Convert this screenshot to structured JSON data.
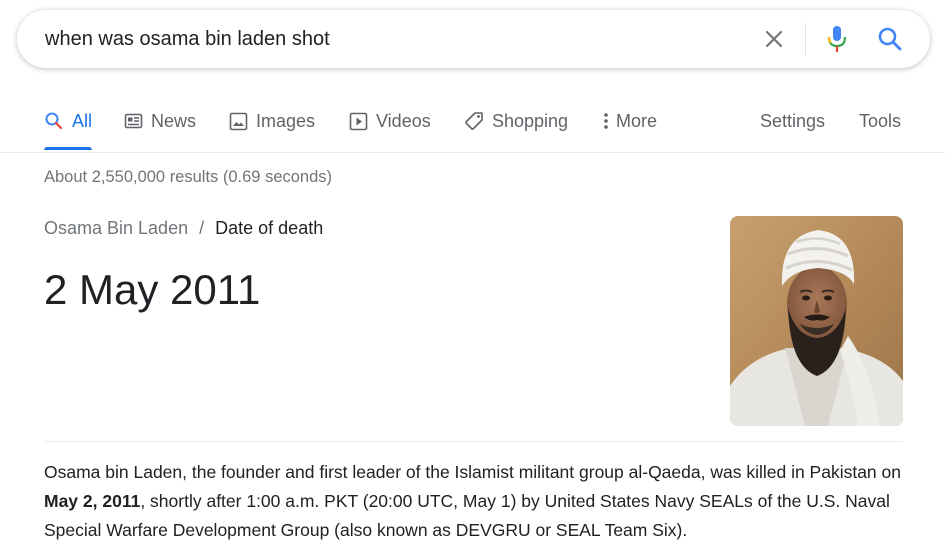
{
  "search": {
    "query": "when was osama bin laden shot"
  },
  "tabs": [
    {
      "label": "All",
      "icon": "search-icon",
      "active": true
    },
    {
      "label": "News",
      "icon": "news-icon"
    },
    {
      "label": "Images",
      "icon": "image-icon"
    },
    {
      "label": "Videos",
      "icon": "video-icon"
    },
    {
      "label": "Shopping",
      "icon": "tag-icon"
    },
    {
      "label": "More",
      "icon": "more-vertical-icon"
    }
  ],
  "tools": {
    "settings_label": "Settings",
    "tools_label": "Tools"
  },
  "results_stats": "About 2,550,000 results (0.69 seconds)",
  "knowledge": {
    "entity": "Osama Bin Laden",
    "separator": "/",
    "attribute": "Date of death",
    "answer": "2 May 2011"
  },
  "snippet": {
    "part1": "Osama bin Laden, the founder and first leader of the Islamist militant group al-Qaeda, was killed in Pakistan on ",
    "bold": "May 2, 2011",
    "part2": ", shortly after 1:00 a.m. PKT (20:00 UTC, May 1) by United States Navy SEALs of the U.S. Naval Special Warfare Development Group (also known as DEVGRU or SEAL Team Six)."
  },
  "colors": {
    "accent": "#1a73e8",
    "text": "#202124",
    "muted": "#70757a"
  }
}
